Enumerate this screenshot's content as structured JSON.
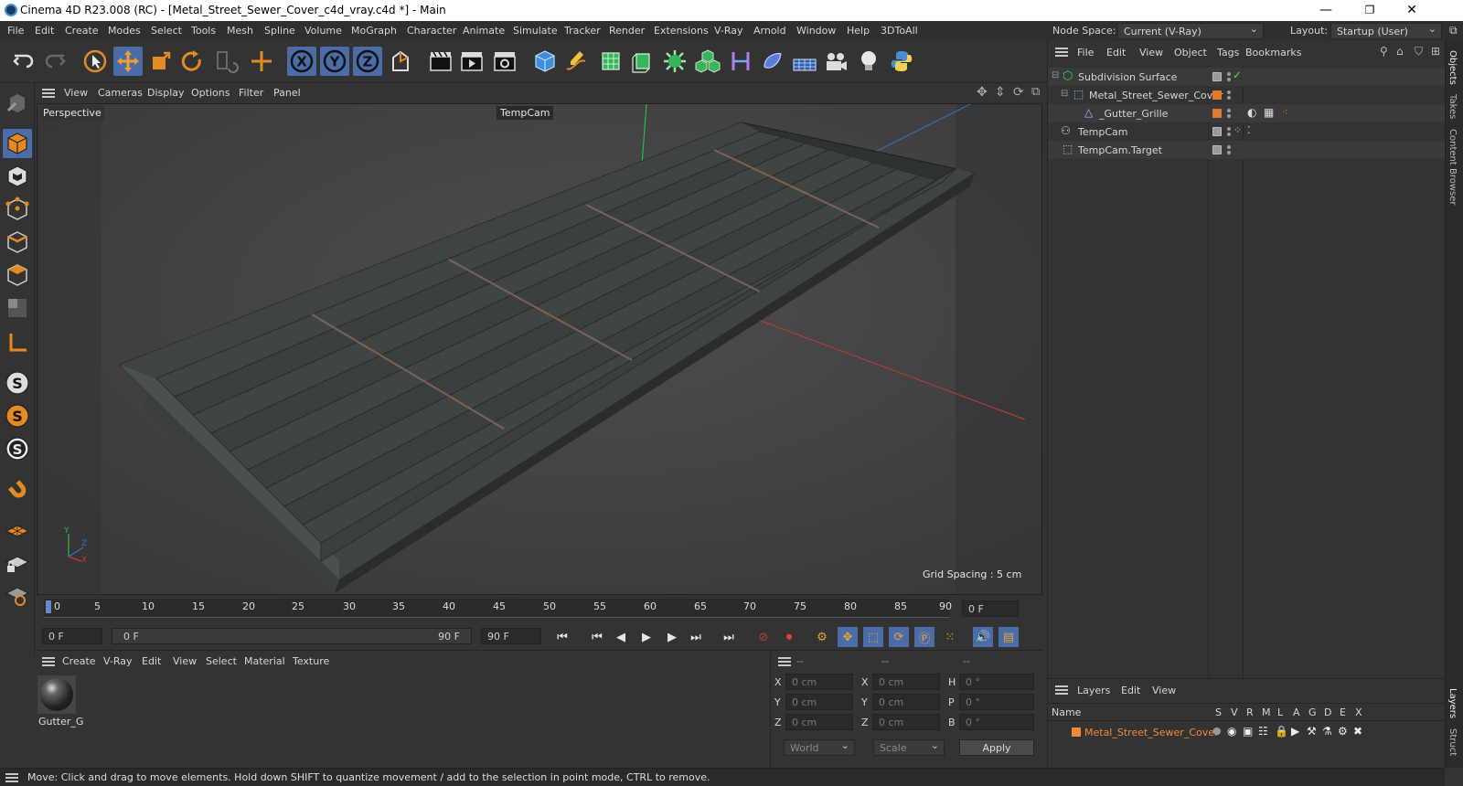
{
  "window": {
    "title": "Cinema 4D R23.008 (RC) - [Metal_Street_Sewer_Cover_c4d_vray.c4d *] - Main",
    "minimize": "—",
    "restore": "❐",
    "close": "✕"
  },
  "menu": [
    "File",
    "Edit",
    "Create",
    "Modes",
    "Select",
    "Tools",
    "Mesh",
    "Spline",
    "Volume",
    "MoGraph",
    "Character",
    "Animate",
    "Simulate",
    "Tracker",
    "Render",
    "Extensions",
    "V-Ray",
    "Arnold",
    "Window",
    "Help",
    "3DToAll"
  ],
  "nodebar": {
    "node_space_label": "Node Space:",
    "node_space_value": "Current (V-Ray)",
    "layout_label": "Layout:",
    "layout_value": "Startup (User)"
  },
  "toolbar_axes": [
    "X",
    "Y",
    "Z"
  ],
  "viewport": {
    "menu": [
      "View",
      "Cameras",
      "Display",
      "Options",
      "Filter",
      "Panel"
    ],
    "view_name": "Perspective",
    "camera_name": "TempCam",
    "grid_spacing": "Grid Spacing : 5 cm",
    "axis_y": "Y",
    "axis_z": "Z",
    "axis_x": "X"
  },
  "timeline": {
    "ticks": [
      "0",
      "5",
      "10",
      "15",
      "20",
      "25",
      "30",
      "35",
      "40",
      "45",
      "50",
      "55",
      "60",
      "65",
      "70",
      "75",
      "80",
      "85",
      "90"
    ],
    "current_frame": "0 F"
  },
  "transport": {
    "start_field": "0 F",
    "range_start": "0 F",
    "range_end": "90 F",
    "end_field": "90 F"
  },
  "material_panel": {
    "menu": [
      "Create",
      "V-Ray",
      "Edit",
      "View",
      "Select",
      "Material",
      "Texture"
    ],
    "material_name": "Gutter_G"
  },
  "coords": {
    "header": [
      "--",
      "--",
      "--"
    ],
    "rows": [
      {
        "a": "X",
        "av": "0 cm",
        "b": "X",
        "bv": "0 cm",
        "c": "H",
        "cv": "0 °"
      },
      {
        "a": "Y",
        "av": "0 cm",
        "b": "Y",
        "bv": "0 cm",
        "c": "P",
        "cv": "0 °"
      },
      {
        "a": "Z",
        "av": "0 cm",
        "b": "Z",
        "bv": "0 cm",
        "c": "B",
        "cv": "0 °"
      }
    ],
    "world": "World",
    "scale": "Scale",
    "apply": "Apply"
  },
  "objects_panel": {
    "menu": [
      "File",
      "Edit",
      "View",
      "Object",
      "Tags",
      "Bookmarks"
    ],
    "items": [
      {
        "name": "Subdivision Surface"
      },
      {
        "name": "Metal_Street_Sewer_Cover"
      },
      {
        "name": "_Gutter_Grille"
      },
      {
        "name": "TempCam"
      },
      {
        "name": "TempCam.Target"
      }
    ]
  },
  "layers_panel": {
    "menu": [
      "Layers",
      "Edit",
      "View"
    ],
    "col_name": "Name",
    "cols": [
      "S",
      "V",
      "R",
      "M",
      "L",
      "A",
      "G",
      "D",
      "E",
      "X"
    ],
    "layer_name": "Metal_Street_Sewer_Cover"
  },
  "right_tabs": [
    "Objects",
    "Takes",
    "Content Browser",
    "Layers",
    "Struct"
  ],
  "status": "Move: Click and drag to move elements. Hold down SHIFT to quantize movement / add to the selection in point mode, CTRL to remove.",
  "colors": {
    "accent": "#4a6da8",
    "orange": "#e07a2e",
    "layer_orange": "#f08a3a"
  }
}
